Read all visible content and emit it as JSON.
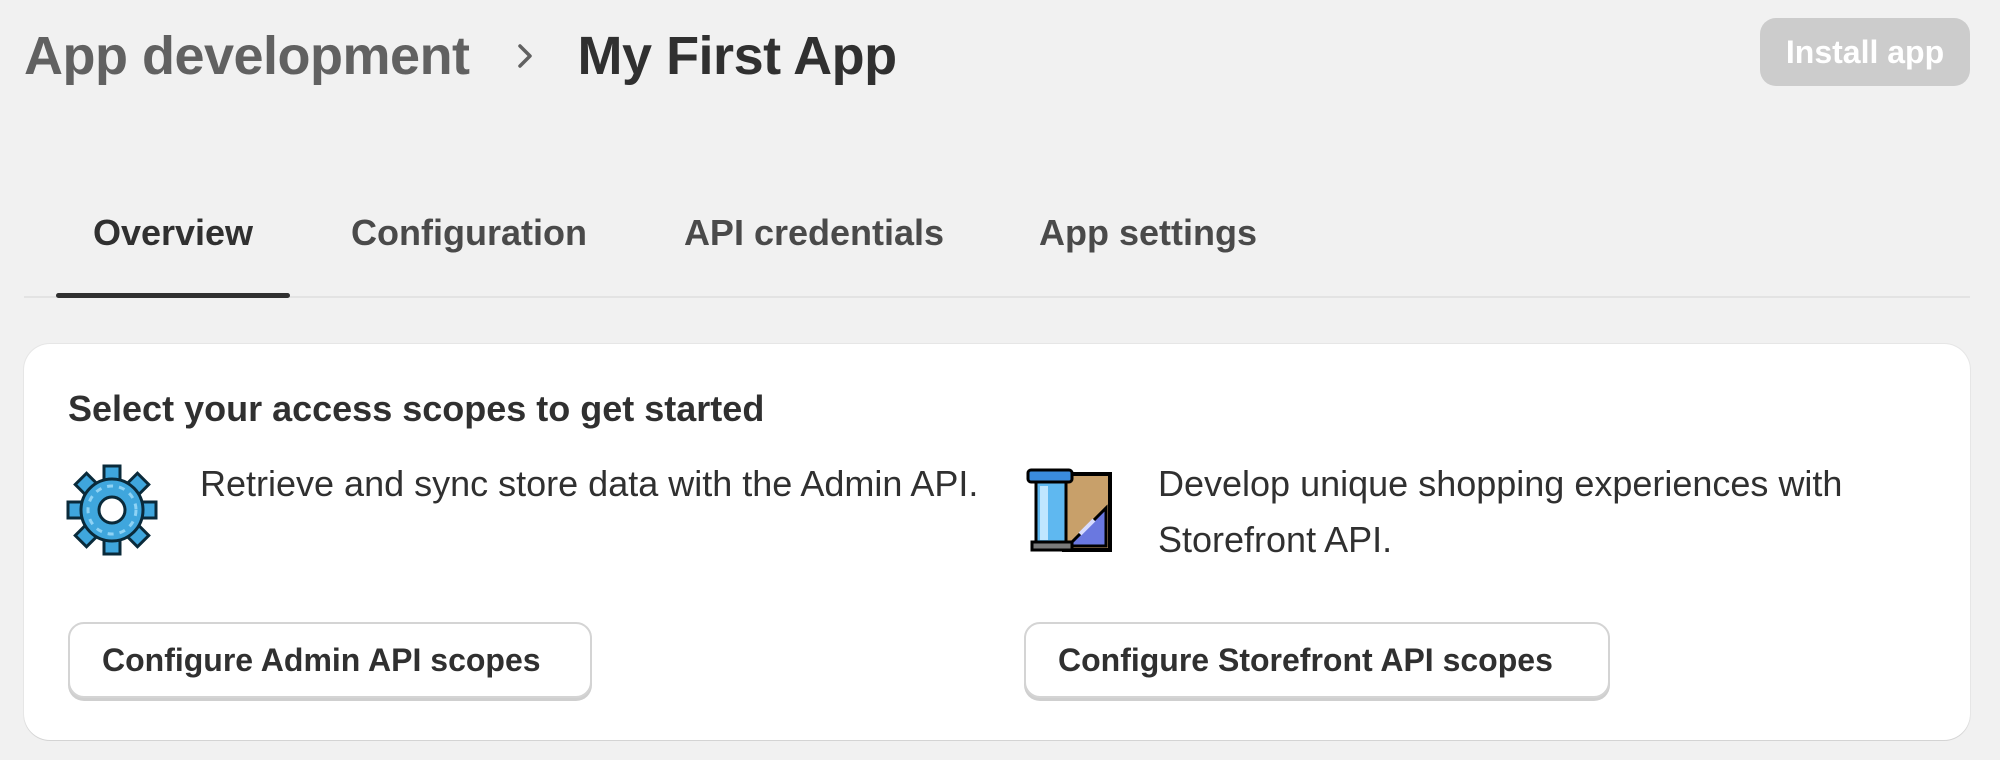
{
  "header": {
    "breadcrumb_parent": "App development",
    "breadcrumb_current": "My First App",
    "install_button": "Install app"
  },
  "tabs": [
    {
      "label": "Overview",
      "active": true
    },
    {
      "label": "Configuration",
      "active": false
    },
    {
      "label": "API credentials",
      "active": false
    },
    {
      "label": "App settings",
      "active": false
    }
  ],
  "card": {
    "title": "Select your access scopes to get started",
    "admin": {
      "icon": "gear-icon",
      "description": "Retrieve and sync store data with the Admin API.",
      "button": "Configure Admin API scopes"
    },
    "storefront": {
      "icon": "storefront-icon",
      "description": "Develop unique shopping experiences with Storefront API.",
      "button": "Configure Storefront API scopes"
    }
  },
  "colors": {
    "background": "#f1f1f1",
    "card": "#ffffff",
    "text": "#303030",
    "muted": "#616161",
    "disabled_button": "#cccccc",
    "gear_blue": "#3fa6dd"
  }
}
